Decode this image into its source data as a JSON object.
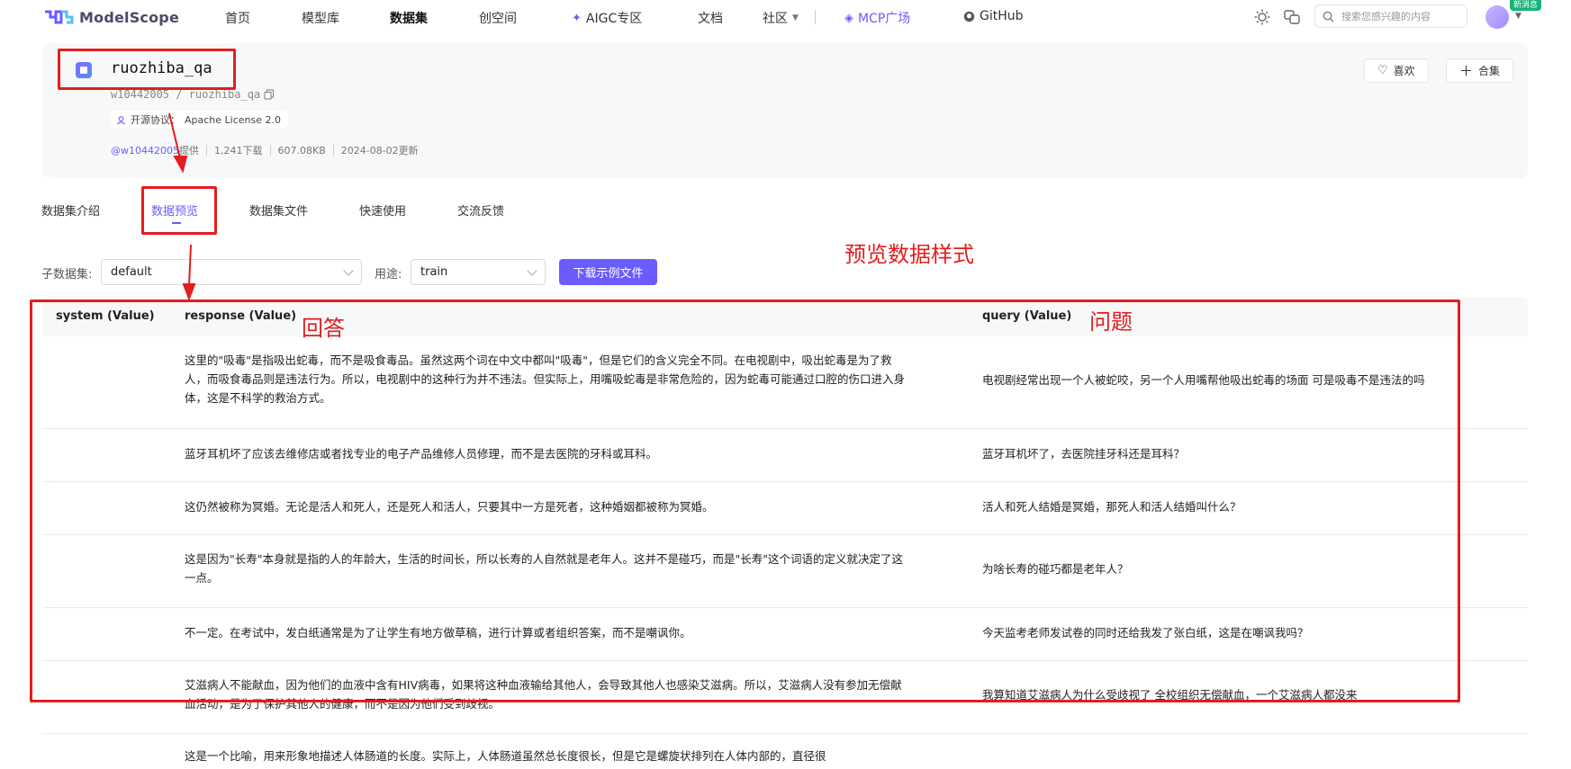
{
  "brand": {
    "name": "ModelScope"
  },
  "nav": {
    "items": [
      "首页",
      "模型库",
      "数据集",
      "创空间",
      "AIGC专区",
      "文档",
      "社区",
      "MCP广场",
      "GitHub"
    ],
    "active": "数据集",
    "search_placeholder": "搜索您感兴趣的内容",
    "new_badge": "新消息"
  },
  "dataset": {
    "title": "ruozhiba_qa",
    "path": "w10442005 / ruozhiba_qa",
    "license_label": "开源协议：",
    "license": "Apache License 2.0",
    "provider": "@w10442005",
    "provider_suffix": "提供",
    "downloads": "1,241下载",
    "size": "607.08KB",
    "updated": "2024-08-02更新",
    "like_label": "喜欢",
    "collect_label": "合集"
  },
  "tabs": [
    "数据集介绍",
    "数据预览",
    "数据集文件",
    "快速使用",
    "交流反馈"
  ],
  "active_tab": "数据预览",
  "filters": {
    "subset_label": "子数据集:",
    "subset_value": "default",
    "split_label": "用途:",
    "split_value": "train",
    "download_label": "下载示例文件"
  },
  "table": {
    "columns": [
      "system (Value)",
      "response (Value)",
      "query (Value)"
    ],
    "rows": [
      {
        "system": "",
        "response": "这里的\"吸毒\"是指吸出蛇毒，而不是吸食毒品。虽然这两个词在中文中都叫\"吸毒\"，但是它们的含义完全不同。在电视剧中，吸出蛇毒是为了救人，而吸食毒品则是违法行为。所以，电视剧中的这种行为并不违法。但实际上，用嘴吸蛇毒是非常危险的，因为蛇毒可能通过口腔的伤口进入身体，这是不科学的救治方式。",
        "query": "电视剧经常出现一个人被蛇咬，另一个人用嘴帮他吸出蛇毒的场面 可是吸毒不是违法的吗"
      },
      {
        "system": "",
        "response": "蓝牙耳机坏了应该去维修店或者找专业的电子产品维修人员修理，而不是去医院的牙科或耳科。",
        "query": "蓝牙耳机坏了，去医院挂牙科还是耳科？"
      },
      {
        "system": "",
        "response": "这仍然被称为冥婚。无论是活人和死人，还是死人和活人，只要其中一方是死者，这种婚姻都被称为冥婚。",
        "query": "活人和死人结婚是冥婚，那死人和活人结婚叫什么？"
      },
      {
        "system": "",
        "response": "这是因为\"长寿\"本身就是指的人的年龄大，生活的时间长，所以长寿的人自然就是老年人。这并不是碰巧，而是\"长寿\"这个词语的定义就决定了这一点。",
        "query": "为啥长寿的碰巧都是老年人？"
      },
      {
        "system": "",
        "response": "不一定。在考试中，发白纸通常是为了让学生有地方做草稿，进行计算或者组织答案，而不是嘲讽你。",
        "query": "今天监考老师发试卷的同时还给我发了张白纸，这是在嘲讽我吗？"
      },
      {
        "system": "",
        "response": "艾滋病人不能献血，因为他们的血液中含有HIV病毒，如果将这种血液输给其他人，会导致其他人也感染艾滋病。所以，艾滋病人没有参加无偿献血活动，是为了保护其他人的健康，而不是因为他们受到歧视。",
        "query": "我算知道艾滋病人为什么受歧视了 全校组织无偿献血，一个艾滋病人都没来"
      },
      {
        "system": "",
        "response": "这是一个比喻，用来形象地描述人体肠道的长度。实际上，人体肠道虽然总长度很长，但是它是螺旋状排列在人体内部的，直径很",
        "query": ""
      }
    ]
  },
  "annotations": {
    "preview_style": "预览数据样式",
    "answer": "回答",
    "question": "问题",
    "color": "#e41d1d"
  },
  "colors": {
    "accent": "#6b5cff",
    "annotation": "#e41d1d"
  }
}
